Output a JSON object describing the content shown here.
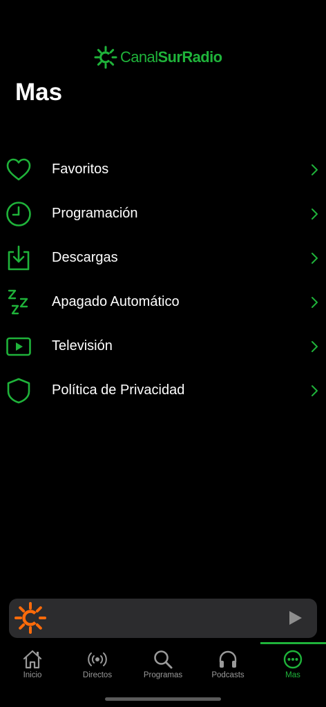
{
  "colors": {
    "accent": "#1fb33a",
    "logo_orange": "#ff6b0a",
    "player_bg": "#2c2c2e",
    "tab_inactive": "#9a9a9a"
  },
  "brand": {
    "canal": "Canal",
    "sur": "Sur",
    "radio": "Radio"
  },
  "page": {
    "title": "Mas"
  },
  "menu": {
    "items": [
      {
        "label": "Favoritos",
        "icon": "heart-icon"
      },
      {
        "label": "Programación",
        "icon": "clock-icon"
      },
      {
        "label": "Descargas",
        "icon": "download-icon"
      },
      {
        "label": "Apagado Automático",
        "icon": "sleep-zzz-icon"
      },
      {
        "label": "Televisión",
        "icon": "tv-play-icon"
      },
      {
        "label": "Política de Privacidad",
        "icon": "shield-icon"
      }
    ]
  },
  "player": {
    "logo": "canalsur-sun-logo",
    "play_icon": "play-icon"
  },
  "tabs": [
    {
      "label": "Inicio",
      "icon": "home-icon",
      "active": false
    },
    {
      "label": "Directos",
      "icon": "broadcast-icon",
      "active": false
    },
    {
      "label": "Programas",
      "icon": "search-icon",
      "active": false
    },
    {
      "label": "Podcasts",
      "icon": "headphones-icon",
      "active": false
    },
    {
      "label": "Mas",
      "icon": "more-icon",
      "active": true
    }
  ]
}
